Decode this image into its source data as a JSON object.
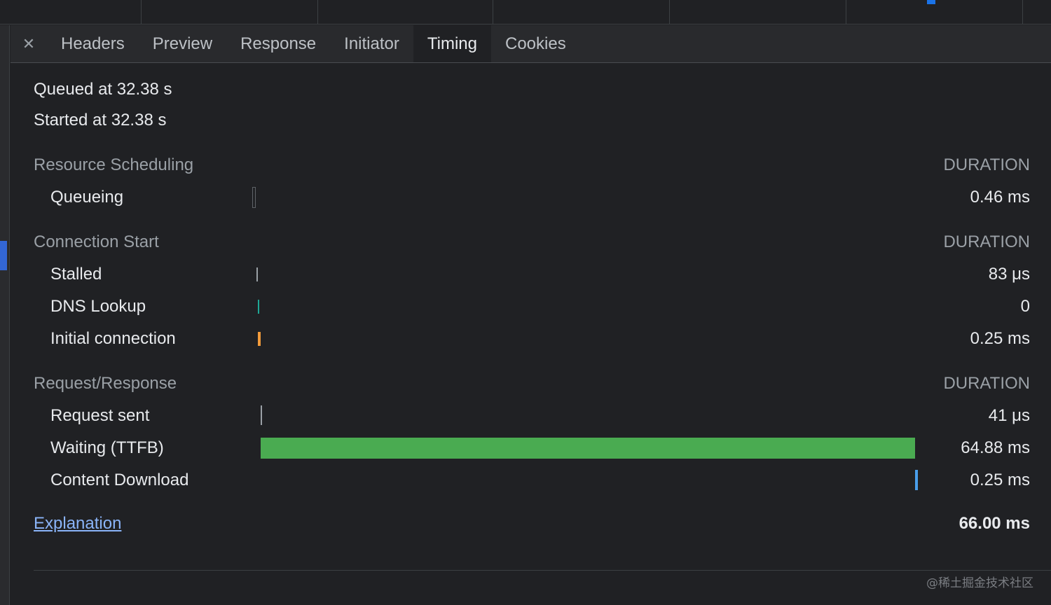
{
  "colors": {
    "queueing": "#5f6368",
    "stalled": "#9aa0a6",
    "dns": "#1ea896",
    "initial_connection": "#f29b3b",
    "request_sent": "#9aa0a6",
    "waiting": "#4aab51",
    "content_download": "#4a9eea"
  },
  "tabs": [
    {
      "label": "Headers"
    },
    {
      "label": "Preview"
    },
    {
      "label": "Response"
    },
    {
      "label": "Initiator"
    },
    {
      "label": "Timing",
      "active": true
    },
    {
      "label": "Cookies"
    }
  ],
  "timing": {
    "queued_at": "Queued at 32.38 s",
    "started_at": "Started at 32.38 s",
    "duration_label": "DURATION",
    "sections": {
      "resource_scheduling": {
        "title": "Resource Scheduling",
        "rows": [
          {
            "label": "Queueing",
            "value": "0.46 ms"
          }
        ]
      },
      "connection_start": {
        "title": "Connection Start",
        "rows": [
          {
            "label": "Stalled",
            "value": "83 μs"
          },
          {
            "label": "DNS Lookup",
            "value": "0"
          },
          {
            "label": "Initial connection",
            "value": "0.25 ms"
          }
        ]
      },
      "request_response": {
        "title": "Request/Response",
        "rows": [
          {
            "label": "Request sent",
            "value": "41 μs"
          },
          {
            "label": "Waiting (TTFB)",
            "value": "64.88 ms"
          },
          {
            "label": "Content Download",
            "value": "0.25 ms"
          }
        ]
      }
    },
    "explanation_link": "Explanation",
    "total": "66.00 ms"
  },
  "watermark": "@稀土掘金技术社区"
}
